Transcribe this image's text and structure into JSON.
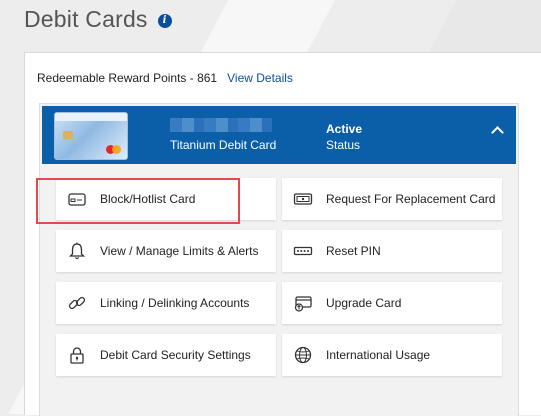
{
  "page": {
    "title": "Debit Cards"
  },
  "rewards": {
    "label": "Redeemable Reward Points - 861",
    "link": "View Details"
  },
  "card": {
    "name": "Titanium Debit Card",
    "status_value": "Active",
    "status_label": "Status"
  },
  "actions": [
    {
      "label": "Block/Hotlist Card",
      "icon": "card-icon"
    },
    {
      "label": "Request For Replacement Card",
      "icon": "card-outline-icon"
    },
    {
      "label": "View / Manage Limits & Alerts",
      "icon": "bell-icon"
    },
    {
      "label": "Reset PIN",
      "icon": "pin-dots-icon"
    },
    {
      "label": "Linking / Delinking Accounts",
      "icon": "link-icon"
    },
    {
      "label": "Upgrade Card",
      "icon": "upgrade-card-icon"
    },
    {
      "label": "Debit Card Security Settings",
      "icon": "lock-icon"
    },
    {
      "label": "International Usage",
      "icon": "globe-icon"
    }
  ],
  "colors": {
    "brand": "#0b5ea8",
    "link": "#0b4f9c",
    "highlight": "#e24a4f"
  }
}
